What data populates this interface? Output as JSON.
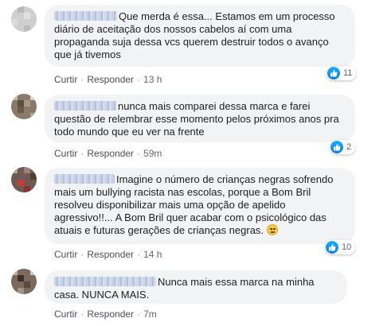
{
  "comments": [
    {
      "text": "Que merda é essa... Estamos em um processo diário de aceitação dos nossos cabelos aí com uma propaganda suja dessa vcs querem destruir todos o avanço que já tivemos",
      "like_label": "Curtir",
      "reply_label": "Responder",
      "time": "13 h",
      "reactions": "11"
    },
    {
      "text": "nunca mais comparei dessa marca e farei questão de relembrar esse momento pelos próximos anos pra todo mundo que eu ver na frente",
      "like_label": "Curtir",
      "reply_label": "Responder",
      "time": "59m",
      "reactions": "2"
    },
    {
      "text": "Imagine o número de crianças negras sofrendo mais um bullying racista nas escolas, porque a Bom Bril resolveu disponibilizar mais uma opção de apelido agressivo!!... A Bom Bril quer acabar com o psicológico das atuais e futuras gerações de crianças negras.",
      "like_label": "Curtir",
      "reply_label": "Responder",
      "time": "14 h",
      "reactions": "10"
    },
    {
      "text": "Nunca mais essa marca na minha casa. NUNCA MAIS.",
      "like_label": "Curtir",
      "reply_label": "Responder",
      "time": "7m"
    }
  ],
  "icons": {
    "reaction": "like-thumb-icon",
    "emoji": "grimacing-face-emoji"
  },
  "colors": {
    "like_blue": "#1877f2",
    "bubble_bg": "#f2f3f5",
    "meta_text": "#606770"
  }
}
